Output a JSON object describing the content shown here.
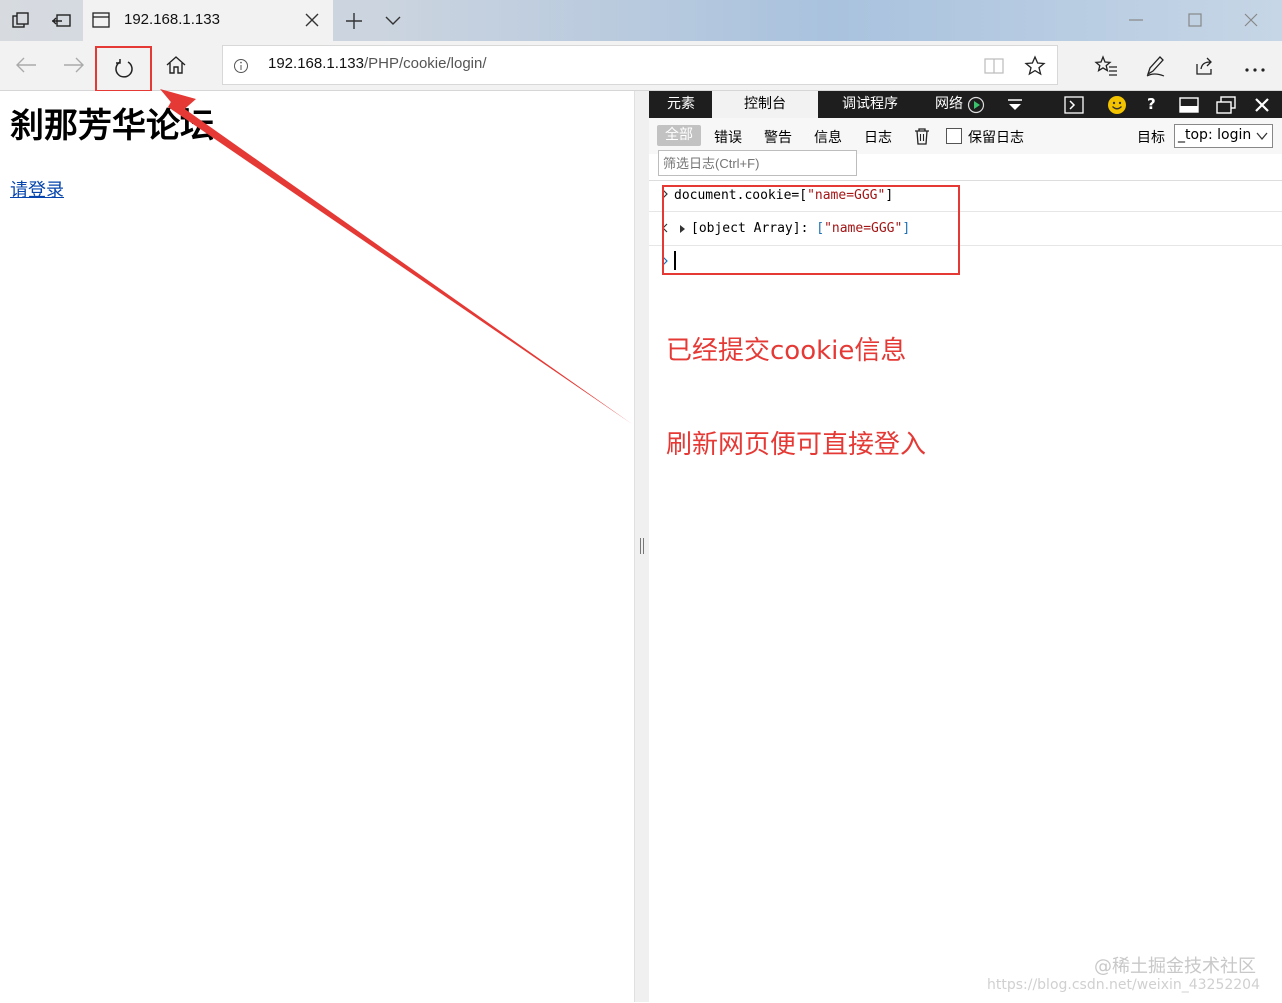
{
  "browser": {
    "tab_title": "192.168.1.133",
    "address": {
      "host": "192.168.1.133",
      "path": "/PHP/cookie/login/"
    }
  },
  "page": {
    "title": "刹那芳华论坛",
    "login_link": "请登录"
  },
  "devtools": {
    "tabs": [
      "元素",
      "控制台",
      "调试程序",
      "网络"
    ],
    "filters": [
      "全部",
      "错误",
      "警告",
      "信息",
      "日志"
    ],
    "preserve_log": "保留日志",
    "search_placeholder": "筛选日志(Ctrl+F)",
    "target_label": "目标",
    "target_value": "_top: login",
    "console": {
      "input_prefix": "document.cookie=[",
      "input_string": "\"name=GGG\"",
      "input_suffix": "]",
      "output_label": "[object Array]: ",
      "output_open": "[",
      "output_string": "\"name=GGG\"",
      "output_close": "]"
    }
  },
  "annotations": {
    "note1": "已经提交cookie信息",
    "note2": "刷新网页便可直接登入"
  },
  "watermark": {
    "line1": "@稀土掘金技术社区",
    "line2": "https://blog.csdn.net/weixin_43252204"
  },
  "colors": {
    "annotation": "#e53935",
    "link": "#0645ad"
  }
}
